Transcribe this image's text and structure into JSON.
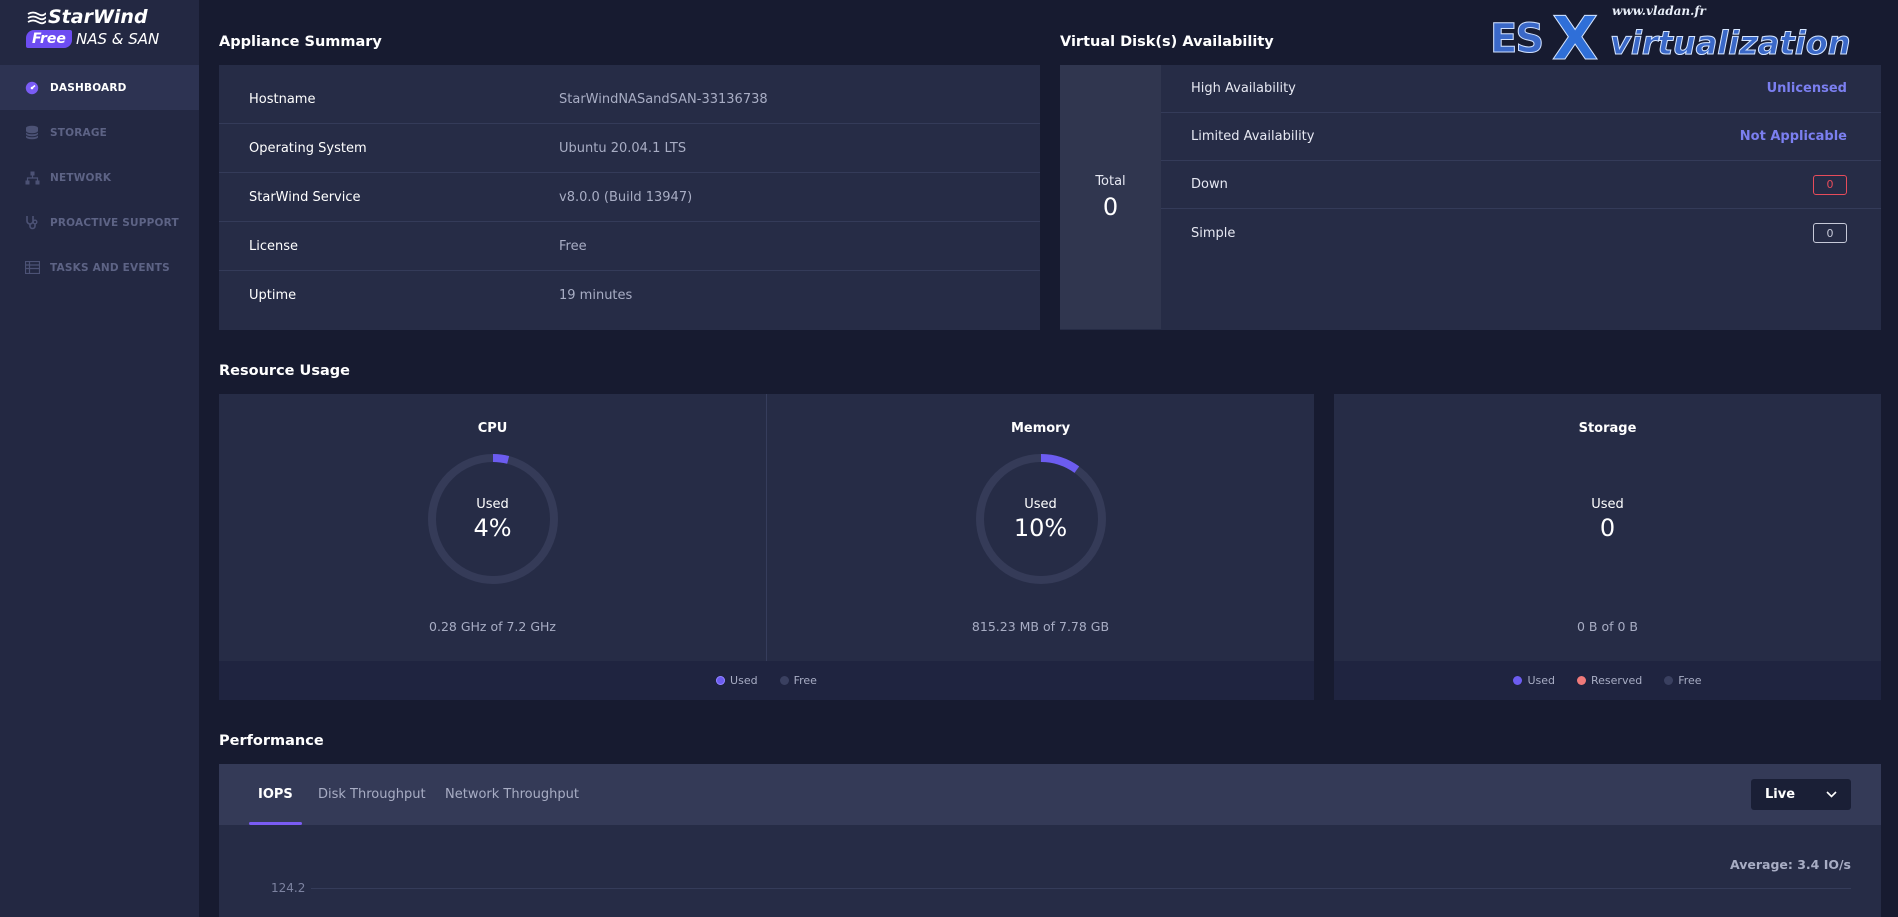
{
  "app": {
    "brand_line1": "StarWind",
    "brand_free": "Free",
    "brand_line2": "NAS & SAN"
  },
  "sidebar": {
    "items": [
      {
        "label": "DASHBOARD",
        "icon": "dashboard-icon",
        "active": true
      },
      {
        "label": "STORAGE",
        "icon": "database-icon",
        "active": false
      },
      {
        "label": "NETWORK",
        "icon": "network-icon",
        "active": false
      },
      {
        "label": "PROACTIVE SUPPORT",
        "icon": "stethoscope-icon",
        "active": false
      },
      {
        "label": "TASKS AND EVENTS",
        "icon": "table-icon",
        "active": false
      }
    ]
  },
  "appliance_summary": {
    "title": "Appliance Summary",
    "rows": [
      {
        "key": "Hostname",
        "value": "StarWindNASandSAN-33136738"
      },
      {
        "key": "Operating System",
        "value": "Ubuntu 20.04.1 LTS"
      },
      {
        "key": "StarWind Service",
        "value": "v8.0.0 (Build 13947)"
      },
      {
        "key": "License",
        "value": "Free"
      },
      {
        "key": "Uptime",
        "value": "19 minutes"
      }
    ]
  },
  "virtual_disks": {
    "title": "Virtual Disk(s) Availability",
    "total_label": "Total",
    "total_value": "0",
    "rows": [
      {
        "label": "High Availability",
        "value": "Unlicensed"
      },
      {
        "label": "Limited Availability",
        "value": "Not Applicable"
      },
      {
        "label": "Down",
        "value": "0"
      },
      {
        "label": "Simple",
        "value": "0"
      }
    ]
  },
  "resource_usage": {
    "title": "Resource Usage",
    "cpu": {
      "title": "CPU",
      "used_label": "Used",
      "percent_text": "4%",
      "percent": 4,
      "detail": "0.28 GHz of 7.2 GHz"
    },
    "memory": {
      "title": "Memory",
      "used_label": "Used",
      "percent_text": "10%",
      "percent": 10,
      "detail": "815.23 MB of 7.78 GB"
    },
    "storage": {
      "title": "Storage",
      "used_label": "Used",
      "value": "0",
      "detail": "0 B of 0 B"
    },
    "legend_compute": [
      {
        "label": "Used",
        "color": "#6c5cf0"
      },
      {
        "label": "Free",
        "color": "#3a4060"
      }
    ],
    "legend_storage": [
      {
        "label": "Used",
        "color": "#6c5cf0"
      },
      {
        "label": "Reserved",
        "color": "#f07a7a"
      },
      {
        "label": "Free",
        "color": "#3a4060"
      }
    ]
  },
  "performance": {
    "title": "Performance",
    "tabs": [
      "IOPS",
      "Disk Throughput",
      "Network Throughput"
    ],
    "active_tab": "IOPS",
    "range": "Live",
    "average": "Average: 3.4 IO/s",
    "y_tick": "124.2"
  },
  "watermark": {
    "url": "www.vladan.fr",
    "es": "ES",
    "x": "X",
    "rest": "virtualization"
  },
  "colors": {
    "accent": "#7a5cf4",
    "link": "#7b7ff0",
    "danger": "#e74c5b"
  }
}
